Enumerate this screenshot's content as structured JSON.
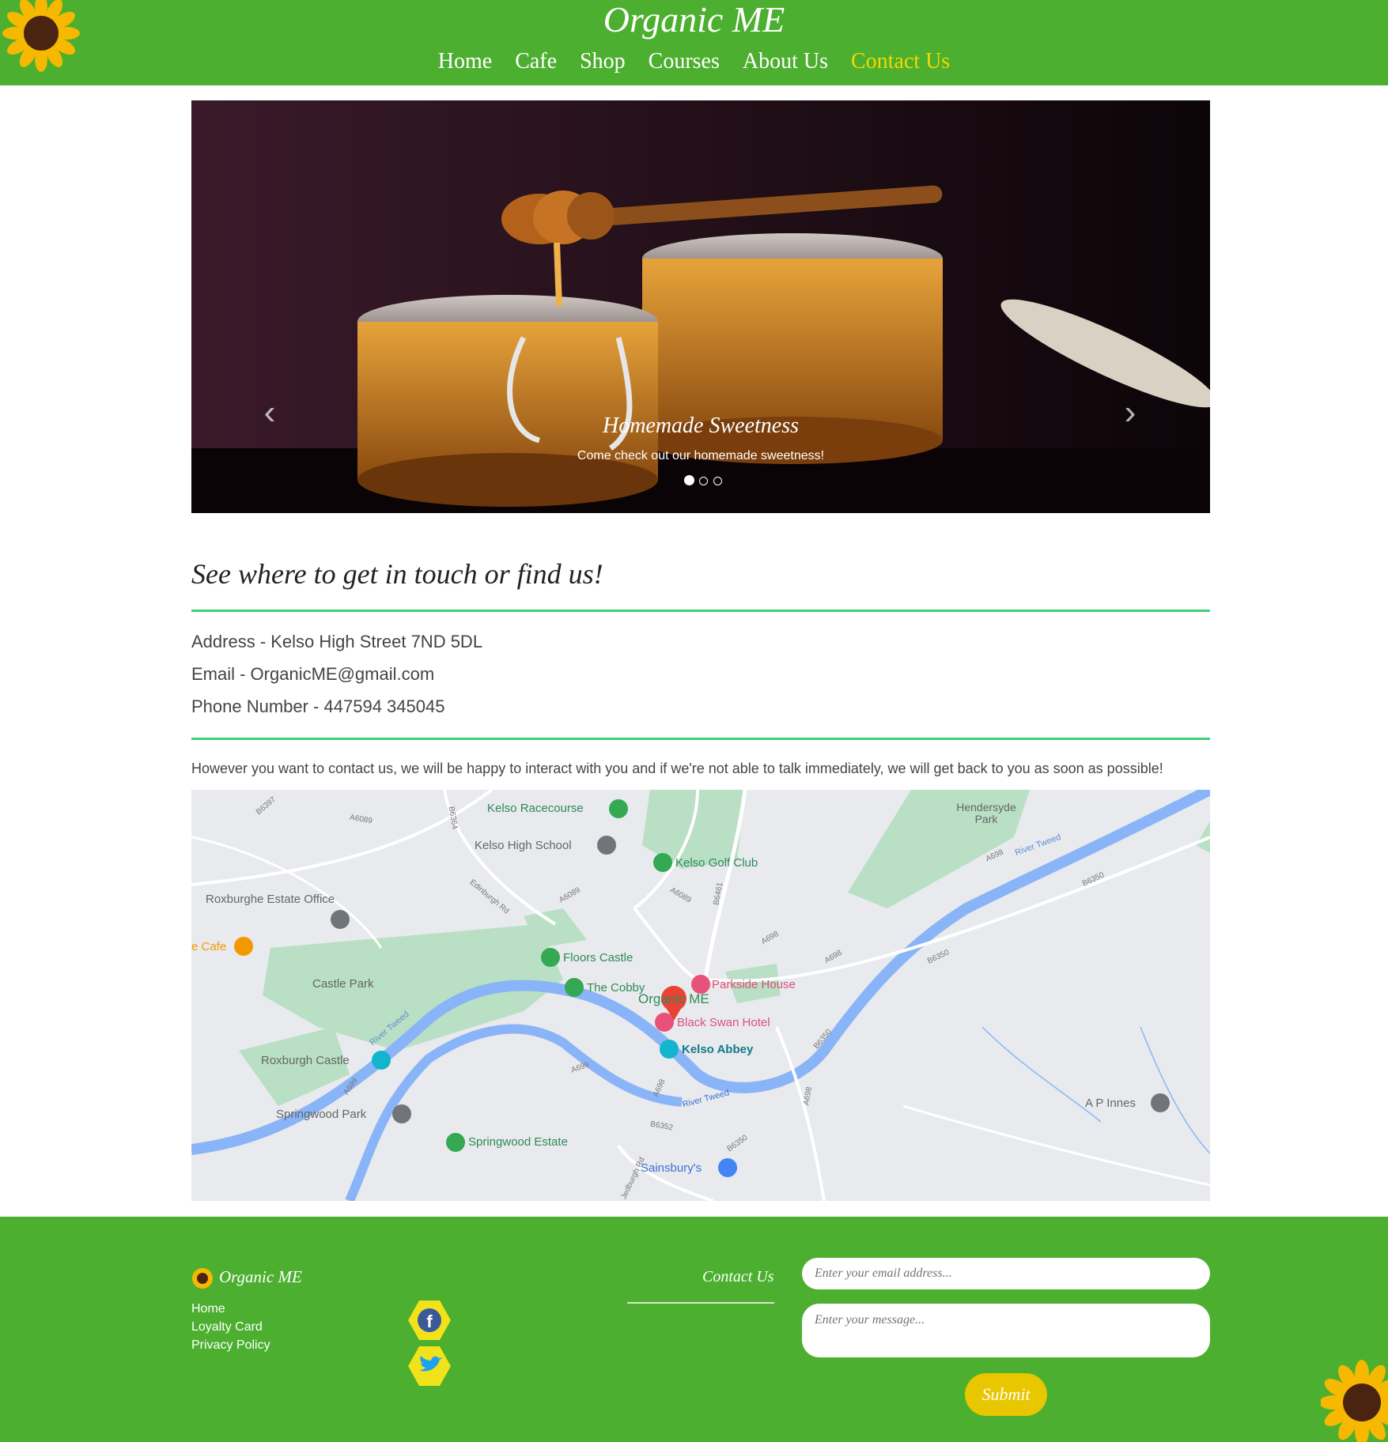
{
  "header": {
    "site_title": "Organic ME",
    "logo_text": "Organic ME",
    "nav": [
      {
        "label": "Home"
      },
      {
        "label": "Cafe"
      },
      {
        "label": "Shop"
      },
      {
        "label": "Courses"
      },
      {
        "label": "About Us"
      },
      {
        "label": "Contact Us",
        "active": true
      }
    ]
  },
  "hero": {
    "caption_title": "Homemade Sweetness",
    "caption_text": "Come check out our homemade sweetness!",
    "prev_icon": "chevron-left-icon",
    "next_icon": "chevron-right-icon",
    "slides": 3,
    "active_slide": 1
  },
  "contact": {
    "heading": "See where to get in touch or find us!",
    "address": "Address - Kelso High Street 7ND 5DL",
    "email": "Email - OrganicME@gmail.com",
    "phone": "Phone Number - 447594 345045",
    "note": "However you want to contact us, we will be happy to interact with you and if we're not able to talk immediately, we will get back to you as soon as possible!"
  },
  "map": {
    "places": [
      {
        "name": "Kelso Racecourse"
      },
      {
        "name": "Kelso High School"
      },
      {
        "name": "Kelso Golf Club"
      },
      {
        "name": "Hendersyde Park"
      },
      {
        "name": "Roxburghe Estate Office"
      },
      {
        "name": "e Cafe"
      },
      {
        "name": "Castle Park"
      },
      {
        "name": "Floors Castle"
      },
      {
        "name": "The Cobby"
      },
      {
        "name": "Organic ME"
      },
      {
        "name": "Parkside House"
      },
      {
        "name": "Black Swan Hotel"
      },
      {
        "name": "Kelso Abbey"
      },
      {
        "name": "Roxburgh Castle"
      },
      {
        "name": "Springwood Park"
      },
      {
        "name": "Springwood Estate"
      },
      {
        "name": "Sainsbury's"
      },
      {
        "name": "A P Innes"
      }
    ],
    "roads": [
      "B6397",
      "A6089",
      "B6364",
      "Edinburgh Rd",
      "A6089",
      "A6089",
      "B6461",
      "A698",
      "River Tweed",
      "B6350",
      "A698",
      "B6350",
      "B6350",
      "River Tweed",
      "A699",
      "A699",
      "A698",
      "B6352",
      "B6350",
      "Jedburgh Rd",
      "A698",
      "A698",
      "River Tweed"
    ]
  },
  "footer": {
    "brand": "Organic ME",
    "links": [
      "Home",
      "Loyalty Card",
      "Privacy Policy"
    ],
    "social": [
      {
        "name": "facebook-icon"
      },
      {
        "name": "twitter-icon"
      }
    ],
    "contact_label": "Contact Us",
    "email_placeholder": "Enter your email address...",
    "message_placeholder": "Enter your message...",
    "submit_label": "Submit"
  },
  "colors": {
    "header_green": "#4caf2f",
    "accent_yellow": "#f4d800",
    "rule_green": "#3ed07a",
    "submit_yellow": "#e8c600"
  }
}
